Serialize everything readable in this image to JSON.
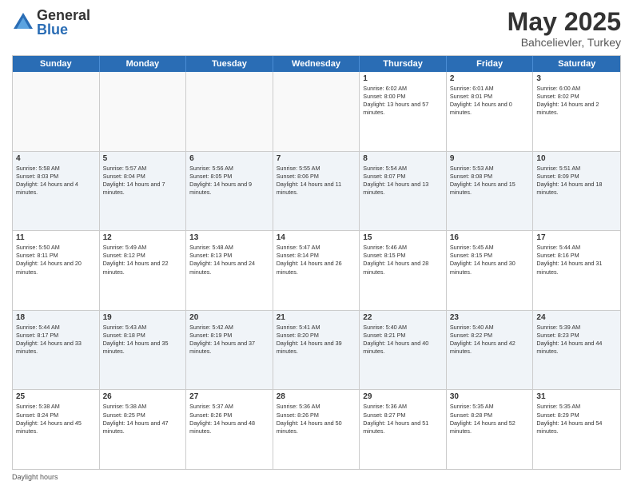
{
  "logo": {
    "general": "General",
    "blue": "Blue"
  },
  "title": {
    "month": "May 2025",
    "location": "Bahcelievler, Turkey"
  },
  "header_days": [
    "Sunday",
    "Monday",
    "Tuesday",
    "Wednesday",
    "Thursday",
    "Friday",
    "Saturday"
  ],
  "rows": [
    [
      {
        "day": "",
        "text": "",
        "empty": true
      },
      {
        "day": "",
        "text": "",
        "empty": true
      },
      {
        "day": "",
        "text": "",
        "empty": true
      },
      {
        "day": "",
        "text": "",
        "empty": true
      },
      {
        "day": "1",
        "text": "Sunrise: 6:02 AM\nSunset: 8:00 PM\nDaylight: 13 hours and 57 minutes.",
        "empty": false
      },
      {
        "day": "2",
        "text": "Sunrise: 6:01 AM\nSunset: 8:01 PM\nDaylight: 14 hours and 0 minutes.",
        "empty": false
      },
      {
        "day": "3",
        "text": "Sunrise: 6:00 AM\nSunset: 8:02 PM\nDaylight: 14 hours and 2 minutes.",
        "empty": false
      }
    ],
    [
      {
        "day": "4",
        "text": "Sunrise: 5:58 AM\nSunset: 8:03 PM\nDaylight: 14 hours and 4 minutes.",
        "empty": false
      },
      {
        "day": "5",
        "text": "Sunrise: 5:57 AM\nSunset: 8:04 PM\nDaylight: 14 hours and 7 minutes.",
        "empty": false
      },
      {
        "day": "6",
        "text": "Sunrise: 5:56 AM\nSunset: 8:05 PM\nDaylight: 14 hours and 9 minutes.",
        "empty": false
      },
      {
        "day": "7",
        "text": "Sunrise: 5:55 AM\nSunset: 8:06 PM\nDaylight: 14 hours and 11 minutes.",
        "empty": false
      },
      {
        "day": "8",
        "text": "Sunrise: 5:54 AM\nSunset: 8:07 PM\nDaylight: 14 hours and 13 minutes.",
        "empty": false
      },
      {
        "day": "9",
        "text": "Sunrise: 5:53 AM\nSunset: 8:08 PM\nDaylight: 14 hours and 15 minutes.",
        "empty": false
      },
      {
        "day": "10",
        "text": "Sunrise: 5:51 AM\nSunset: 8:09 PM\nDaylight: 14 hours and 18 minutes.",
        "empty": false
      }
    ],
    [
      {
        "day": "11",
        "text": "Sunrise: 5:50 AM\nSunset: 8:11 PM\nDaylight: 14 hours and 20 minutes.",
        "empty": false
      },
      {
        "day": "12",
        "text": "Sunrise: 5:49 AM\nSunset: 8:12 PM\nDaylight: 14 hours and 22 minutes.",
        "empty": false
      },
      {
        "day": "13",
        "text": "Sunrise: 5:48 AM\nSunset: 8:13 PM\nDaylight: 14 hours and 24 minutes.",
        "empty": false
      },
      {
        "day": "14",
        "text": "Sunrise: 5:47 AM\nSunset: 8:14 PM\nDaylight: 14 hours and 26 minutes.",
        "empty": false
      },
      {
        "day": "15",
        "text": "Sunrise: 5:46 AM\nSunset: 8:15 PM\nDaylight: 14 hours and 28 minutes.",
        "empty": false
      },
      {
        "day": "16",
        "text": "Sunrise: 5:45 AM\nSunset: 8:15 PM\nDaylight: 14 hours and 30 minutes.",
        "empty": false
      },
      {
        "day": "17",
        "text": "Sunrise: 5:44 AM\nSunset: 8:16 PM\nDaylight: 14 hours and 31 minutes.",
        "empty": false
      }
    ],
    [
      {
        "day": "18",
        "text": "Sunrise: 5:44 AM\nSunset: 8:17 PM\nDaylight: 14 hours and 33 minutes.",
        "empty": false
      },
      {
        "day": "19",
        "text": "Sunrise: 5:43 AM\nSunset: 8:18 PM\nDaylight: 14 hours and 35 minutes.",
        "empty": false
      },
      {
        "day": "20",
        "text": "Sunrise: 5:42 AM\nSunset: 8:19 PM\nDaylight: 14 hours and 37 minutes.",
        "empty": false
      },
      {
        "day": "21",
        "text": "Sunrise: 5:41 AM\nSunset: 8:20 PM\nDaylight: 14 hours and 39 minutes.",
        "empty": false
      },
      {
        "day": "22",
        "text": "Sunrise: 5:40 AM\nSunset: 8:21 PM\nDaylight: 14 hours and 40 minutes.",
        "empty": false
      },
      {
        "day": "23",
        "text": "Sunrise: 5:40 AM\nSunset: 8:22 PM\nDaylight: 14 hours and 42 minutes.",
        "empty": false
      },
      {
        "day": "24",
        "text": "Sunrise: 5:39 AM\nSunset: 8:23 PM\nDaylight: 14 hours and 44 minutes.",
        "empty": false
      }
    ],
    [
      {
        "day": "25",
        "text": "Sunrise: 5:38 AM\nSunset: 8:24 PM\nDaylight: 14 hours and 45 minutes.",
        "empty": false
      },
      {
        "day": "26",
        "text": "Sunrise: 5:38 AM\nSunset: 8:25 PM\nDaylight: 14 hours and 47 minutes.",
        "empty": false
      },
      {
        "day": "27",
        "text": "Sunrise: 5:37 AM\nSunset: 8:26 PM\nDaylight: 14 hours and 48 minutes.",
        "empty": false
      },
      {
        "day": "28",
        "text": "Sunrise: 5:36 AM\nSunset: 8:26 PM\nDaylight: 14 hours and 50 minutes.",
        "empty": false
      },
      {
        "day": "29",
        "text": "Sunrise: 5:36 AM\nSunset: 8:27 PM\nDaylight: 14 hours and 51 minutes.",
        "empty": false
      },
      {
        "day": "30",
        "text": "Sunrise: 5:35 AM\nSunset: 8:28 PM\nDaylight: 14 hours and 52 minutes.",
        "empty": false
      },
      {
        "day": "31",
        "text": "Sunrise: 5:35 AM\nSunset: 8:29 PM\nDaylight: 14 hours and 54 minutes.",
        "empty": false
      }
    ]
  ],
  "footer": "Daylight hours"
}
